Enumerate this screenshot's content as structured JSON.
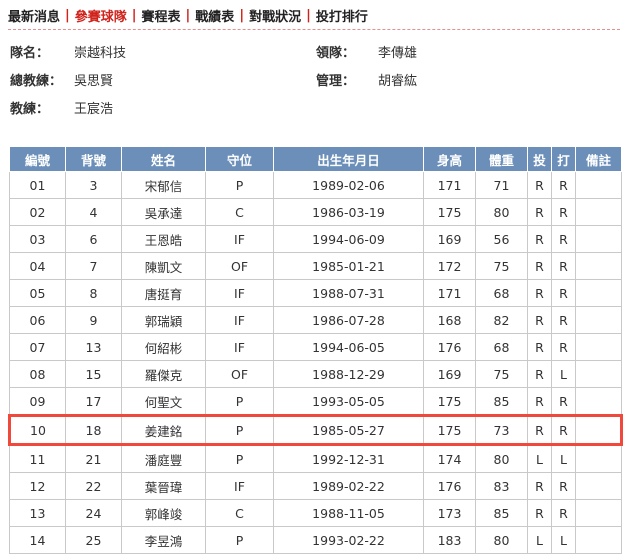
{
  "nav": {
    "items": [
      "最新消息",
      "參賽球隊",
      "賽程表",
      "戰績表",
      "對戰狀況",
      "投打排行"
    ],
    "active_index": 1,
    "separator": "|"
  },
  "team_info": {
    "team_name_label": "隊名：",
    "team_name": "崇越科技",
    "leader_label": "領隊：",
    "leader": "李傳雄",
    "head_coach_label": "總教練：",
    "head_coach": "吳思賢",
    "manager_label": "管理：",
    "manager": "胡睿紘",
    "coach_label": "教練：",
    "coach": "王宸浩"
  },
  "colors": {
    "header_bg": "#6b8fb9",
    "active_nav": "#d0231c",
    "highlight_border": "#f0493c"
  },
  "roster": {
    "headers": [
      "編號",
      "背號",
      "姓名",
      "守位",
      "出生年月日",
      "身高",
      "體重",
      "投",
      "打",
      "備註"
    ],
    "highlight_row_index": 9,
    "rows": [
      [
        "01",
        "3",
        "宋郁信",
        "P",
        "1989-02-06",
        "171",
        "71",
        "R",
        "R",
        ""
      ],
      [
        "02",
        "4",
        "吳承達",
        "C",
        "1986-03-19",
        "175",
        "80",
        "R",
        "R",
        ""
      ],
      [
        "03",
        "6",
        "王恩皓",
        "IF",
        "1994-06-09",
        "169",
        "56",
        "R",
        "R",
        ""
      ],
      [
        "04",
        "7",
        "陳凱文",
        "OF",
        "1985-01-21",
        "172",
        "75",
        "R",
        "R",
        ""
      ],
      [
        "05",
        "8",
        "唐挺育",
        "IF",
        "1988-07-31",
        "171",
        "68",
        "R",
        "R",
        ""
      ],
      [
        "06",
        "9",
        "郭瑞穎",
        "IF",
        "1986-07-28",
        "168",
        "82",
        "R",
        "R",
        ""
      ],
      [
        "07",
        "13",
        "何紹彬",
        "IF",
        "1994-06-05",
        "176",
        "68",
        "R",
        "R",
        ""
      ],
      [
        "08",
        "15",
        "羅傑克",
        "OF",
        "1988-12-29",
        "169",
        "75",
        "R",
        "L",
        ""
      ],
      [
        "09",
        "17",
        "何聖文",
        "P",
        "1993-05-05",
        "175",
        "85",
        "R",
        "R",
        ""
      ],
      [
        "10",
        "18",
        "姜建銘",
        "P",
        "1985-05-27",
        "175",
        "73",
        "R",
        "R",
        ""
      ],
      [
        "11",
        "21",
        "潘庭豐",
        "P",
        "1992-12-31",
        "174",
        "80",
        "L",
        "L",
        ""
      ],
      [
        "12",
        "22",
        "葉晉瑋",
        "IF",
        "1989-02-22",
        "176",
        "83",
        "R",
        "R",
        ""
      ],
      [
        "13",
        "24",
        "郭峰竣",
        "C",
        "1988-11-05",
        "173",
        "85",
        "R",
        "R",
        ""
      ],
      [
        "14",
        "25",
        "李昱鴻",
        "P",
        "1993-02-22",
        "183",
        "80",
        "L",
        "L",
        ""
      ]
    ]
  }
}
